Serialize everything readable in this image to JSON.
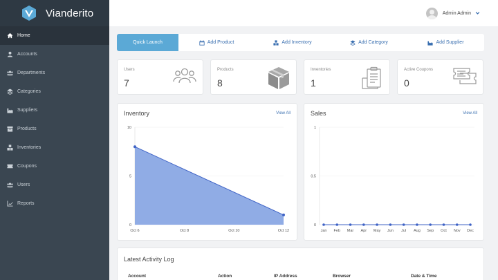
{
  "brand": {
    "name": "Vianderito"
  },
  "sidebar": {
    "items": [
      {
        "label": "Home",
        "icon": "home-icon",
        "active": true
      },
      {
        "label": "Accounts",
        "icon": "user-icon"
      },
      {
        "label": "Departments",
        "icon": "users-icon"
      },
      {
        "label": "Categories",
        "icon": "layers-icon"
      },
      {
        "label": "Suppliers",
        "icon": "industry-icon"
      },
      {
        "label": "Products",
        "icon": "archive-icon"
      },
      {
        "label": "Inventories",
        "icon": "cubes-icon"
      },
      {
        "label": "Coupons",
        "icon": "ticket-icon"
      },
      {
        "label": "Users",
        "icon": "users-icon"
      },
      {
        "label": "Reports",
        "icon": "line-chart-icon"
      }
    ]
  },
  "topbar": {
    "user_name": "Admin Admin"
  },
  "quickbar": {
    "items": [
      {
        "label": "Quick Launch",
        "active": true
      },
      {
        "label": "Add Product",
        "icon": "calendar-icon"
      },
      {
        "label": "Add Inventory",
        "icon": "cubes-icon"
      },
      {
        "label": "Add Category",
        "icon": "layers-icon"
      },
      {
        "label": "Add Supplier",
        "icon": "industry-icon"
      }
    ]
  },
  "stats": [
    {
      "label": "Users",
      "value": "7",
      "icon": "people-outline-icon"
    },
    {
      "label": "Products",
      "value": "8",
      "icon": "box-icon"
    },
    {
      "label": "Inventories",
      "value": "1",
      "icon": "clipboard-icon"
    },
    {
      "label": "Active Coupons",
      "value": "0",
      "icon": "ticket-outline-icon"
    }
  ],
  "inventory_panel": {
    "title": "Inventory",
    "link": "View All"
  },
  "sales_panel": {
    "title": "Sales",
    "link": "View All"
  },
  "activity": {
    "title": "Latest Activity Log",
    "columns": [
      "Account",
      "Action",
      "IP Address",
      "Browser",
      "Date & Time"
    ]
  },
  "colors": {
    "accent": "#5ba9d6",
    "link": "#3a6fb0",
    "area_fill": "#8aa8e4",
    "line": "#3f63c6",
    "sidebar": "#3a4651"
  },
  "chart_data": [
    {
      "type": "area",
      "x": [
        "Oct 6",
        "Oct 12"
      ],
      "values": [
        8,
        1
      ],
      "xticks": [
        "Oct 6",
        "Oct 8",
        "Oct 10",
        "Oct 12"
      ],
      "yticks": [
        "0",
        "5",
        "10"
      ],
      "ylim": [
        0,
        10
      ],
      "grid": true
    },
    {
      "type": "line",
      "categories": [
        "Jan",
        "Feb",
        "Mar",
        "Apr",
        "May",
        "Jun",
        "Jul",
        "Aug",
        "Sep",
        "Oct",
        "Nov",
        "Dec"
      ],
      "values": [
        0,
        0,
        0,
        0,
        0,
        0,
        0,
        0,
        0,
        0,
        0,
        0
      ],
      "yticks": [
        "0",
        "0.5",
        "1"
      ],
      "ylim": [
        0,
        1
      ],
      "grid": true
    }
  ]
}
